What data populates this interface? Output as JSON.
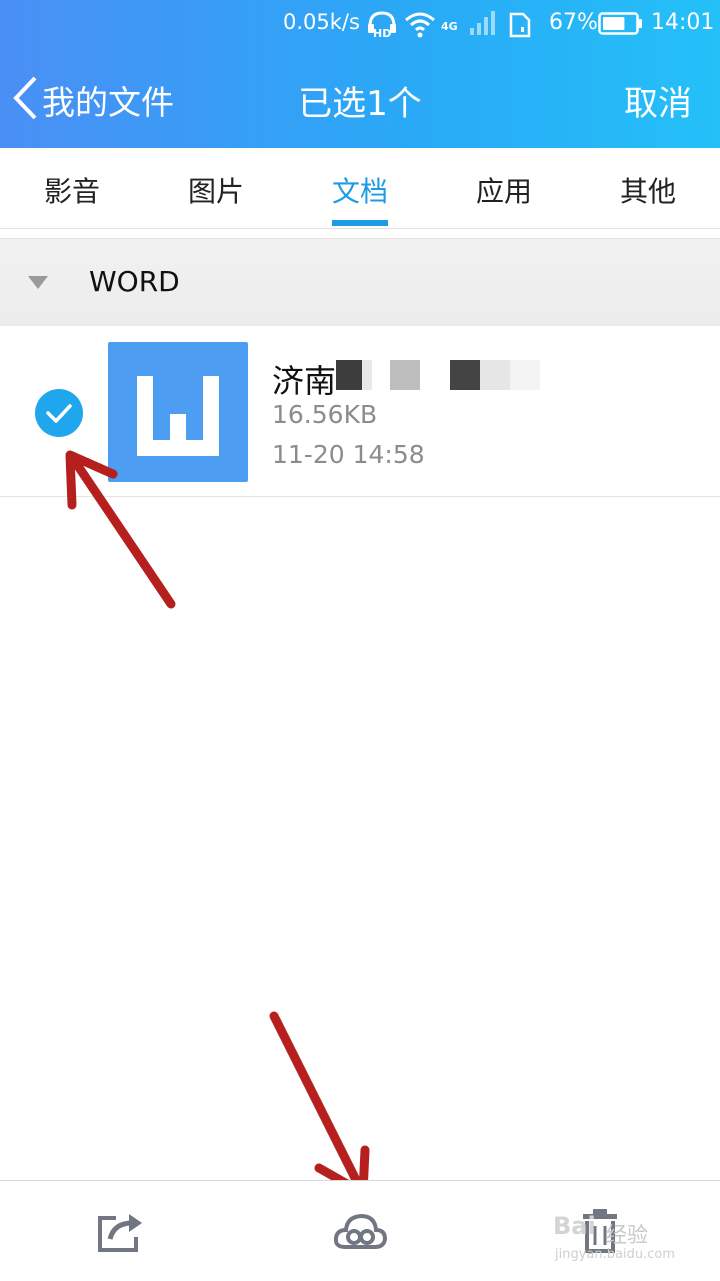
{
  "status_bar": {
    "network_speed": "0.05k/s",
    "hd_label": "HD",
    "network_type": "4G",
    "battery_percent": "67%",
    "battery_level": 0.67,
    "time": "14:01"
  },
  "nav": {
    "back_label": "我的文件",
    "title": "已选1个",
    "cancel_label": "取消"
  },
  "tabs": [
    {
      "label": "影音",
      "active": false
    },
    {
      "label": "图片",
      "active": false
    },
    {
      "label": "文档",
      "active": true
    },
    {
      "label": "应用",
      "active": false
    },
    {
      "label": "其他",
      "active": false
    }
  ],
  "group": {
    "title": "WORD",
    "expanded": true
  },
  "files": [
    {
      "name": "济南",
      "size": "16.56KB",
      "date": "11-20 14:58",
      "selected": true,
      "thumb_letter": "W"
    }
  ],
  "bottom_bar": {
    "icons": [
      "share-icon",
      "cloud-upload-icon",
      "delete-icon"
    ]
  },
  "watermark": {
    "text": "经验",
    "logo": "Bai",
    "url": "jingyan.baidu.com"
  },
  "colors": {
    "header_start": "#4a8ff5",
    "header_end": "#24c0f8",
    "accent": "#1d9be4",
    "doc_thumb": "#4d9ef3",
    "annotation_arrow": "#b5201e"
  }
}
